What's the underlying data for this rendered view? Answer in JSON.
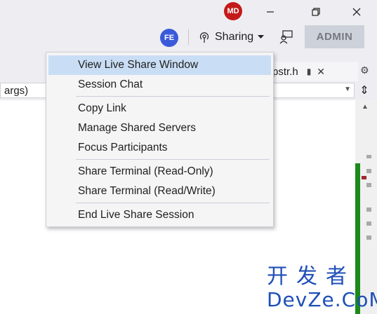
{
  "titlebar": {
    "user_initials": "MD",
    "minimize_icon": "minimize-icon",
    "maximize_icon": "restore-icon",
    "close_icon": "close-icon"
  },
  "toolbar": {
    "liveshare_initials": "FE",
    "sharing_label": "Sharing",
    "admin_label": "ADMIN"
  },
  "editor": {
    "tab_title": "pstr.h",
    "nav_combo_text": "args)"
  },
  "menu": {
    "items": [
      {
        "label": "View Live Share Window"
      },
      {
        "label": "Session Chat"
      },
      {
        "label": "Copy Link"
      },
      {
        "label": "Manage Shared Servers"
      },
      {
        "label": "Focus Participants"
      },
      {
        "label": "Share Terminal (Read-Only)"
      },
      {
        "label": "Share Terminal (Read/Write)"
      },
      {
        "label": "End Live Share Session"
      }
    ]
  },
  "watermark": {
    "cn": "开发者",
    "en": "DevZe.CoM"
  },
  "colors": {
    "accent_highlight": "#c9def5",
    "avatar_md": "#c41a1a",
    "avatar_fe": "#3a5bd9",
    "marker_green": "#1a8a1a",
    "marker_red": "#a0282f"
  }
}
